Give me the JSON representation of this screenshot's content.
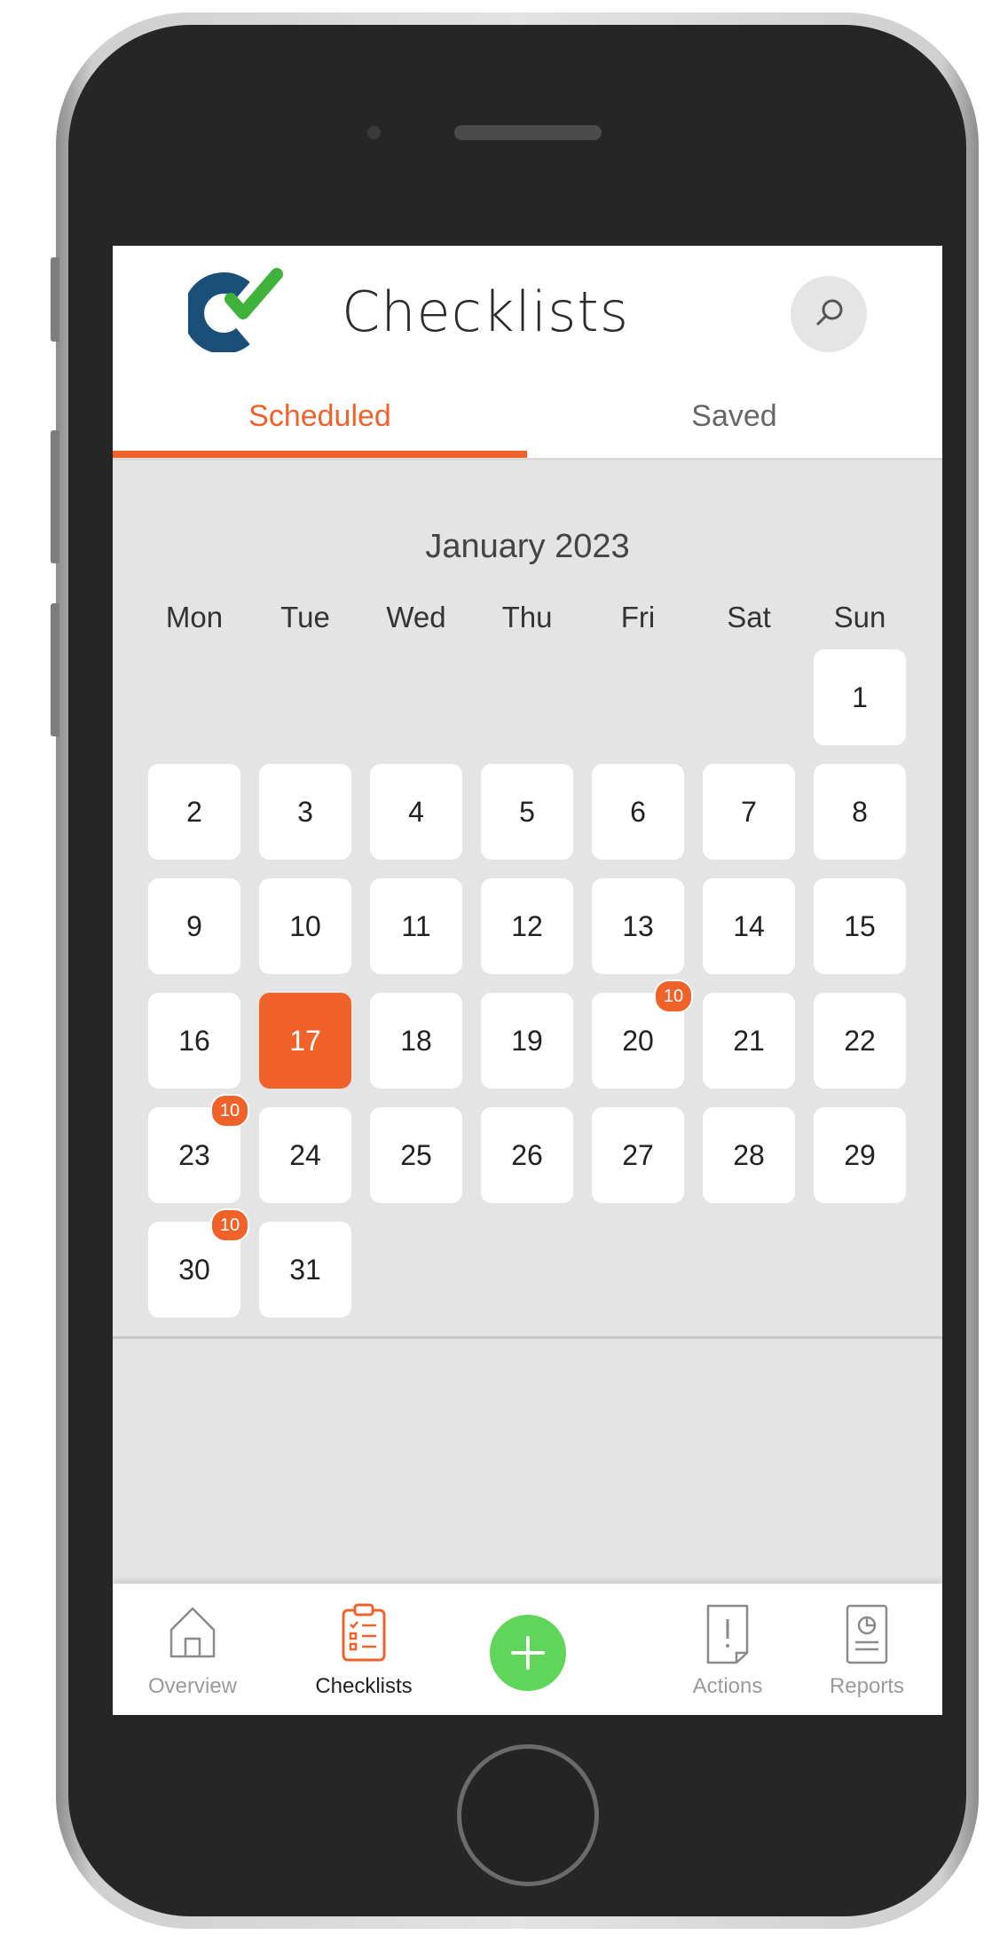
{
  "app": {
    "title": "Checklists"
  },
  "tabs": [
    {
      "label": "Scheduled",
      "active": true
    },
    {
      "label": "Saved",
      "active": false
    }
  ],
  "calendar": {
    "month_title": "January 2023",
    "weekdays": [
      "Mon",
      "Tue",
      "Wed",
      "Thu",
      "Fri",
      "Sat",
      "Sun"
    ],
    "days": [
      "1",
      "2",
      "3",
      "4",
      "5",
      "6",
      "7",
      "8",
      "9",
      "10",
      "11",
      "12",
      "13",
      "14",
      "15",
      "16",
      "17",
      "18",
      "19",
      "20",
      "21",
      "22",
      "23",
      "24",
      "25",
      "26",
      "27",
      "28",
      "29",
      "30",
      "31"
    ],
    "selected_day": "17",
    "badges": {
      "20": "10",
      "23": "10",
      "30": "10"
    }
  },
  "nav": {
    "overview": "Overview",
    "checklists": "Checklists",
    "actions": "Actions",
    "reports": "Reports",
    "add_icon": "plus-icon"
  },
  "colors": {
    "accent": "#f0622a",
    "fab": "#5fd65a",
    "logo_blue": "#1a4f7a",
    "logo_green": "#3fb23b"
  }
}
